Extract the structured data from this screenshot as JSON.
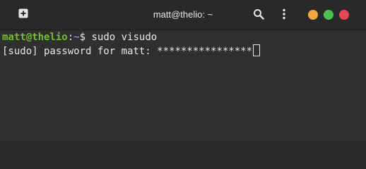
{
  "window": {
    "title": "matt@thelio: ~",
    "controls": {
      "minimize_color": "#f2a93b",
      "maximize_color": "#4fbf4f",
      "close_color": "#e5484d"
    },
    "icons": {
      "new_tab": "new-tab-icon",
      "search": "search-icon",
      "menu": "kebab-menu-icon"
    }
  },
  "terminal": {
    "line1": {
      "user_host": "matt@thelio",
      "colon": ":",
      "path": "~",
      "prompt_symbol": "$",
      "command": " sudo visudo"
    },
    "line2": {
      "text": "[sudo] password for matt: ",
      "masked_input": "****************"
    },
    "colors": {
      "user_host": "#6fbf2a",
      "path": "#8ab4f8",
      "text": "#e8e8e8",
      "background": "#2f2f2f"
    }
  }
}
